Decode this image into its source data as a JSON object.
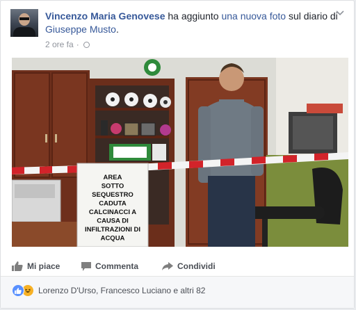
{
  "post": {
    "actor": "Vincenzo Maria Genovese",
    "action_text": " ha aggiunto ",
    "object_link": "una nuova foto",
    "target_prefix": " sul diario di ",
    "target": "Giuseppe Musto",
    "period": ".",
    "timestamp": "2 ore fa",
    "separator": "·",
    "privacy_icon": "globe-icon",
    "menu_icon": "chevron-down-icon"
  },
  "photo": {
    "sign_lines": [
      "AREA",
      "SOTTO",
      "SEQUESTRO",
      "CADUTA",
      "CALCINACCI A",
      "CAUSA DI",
      "INFILTRAZIONI DI",
      "ACQUA"
    ]
  },
  "actions": {
    "like_label": "Mi piace",
    "comment_label": "Commenta",
    "share_label": "Condividi"
  },
  "reactions": {
    "names": "Lorenzo D'Urso, Francesco Luciano e altri 82",
    "icons": [
      "like-reaction-icon",
      "haha-reaction-icon"
    ]
  },
  "colors": {
    "link": "#365899",
    "like_blue": "#5890ff",
    "haha_yellow": "#f7b125",
    "meta_grey": "#90949c"
  }
}
